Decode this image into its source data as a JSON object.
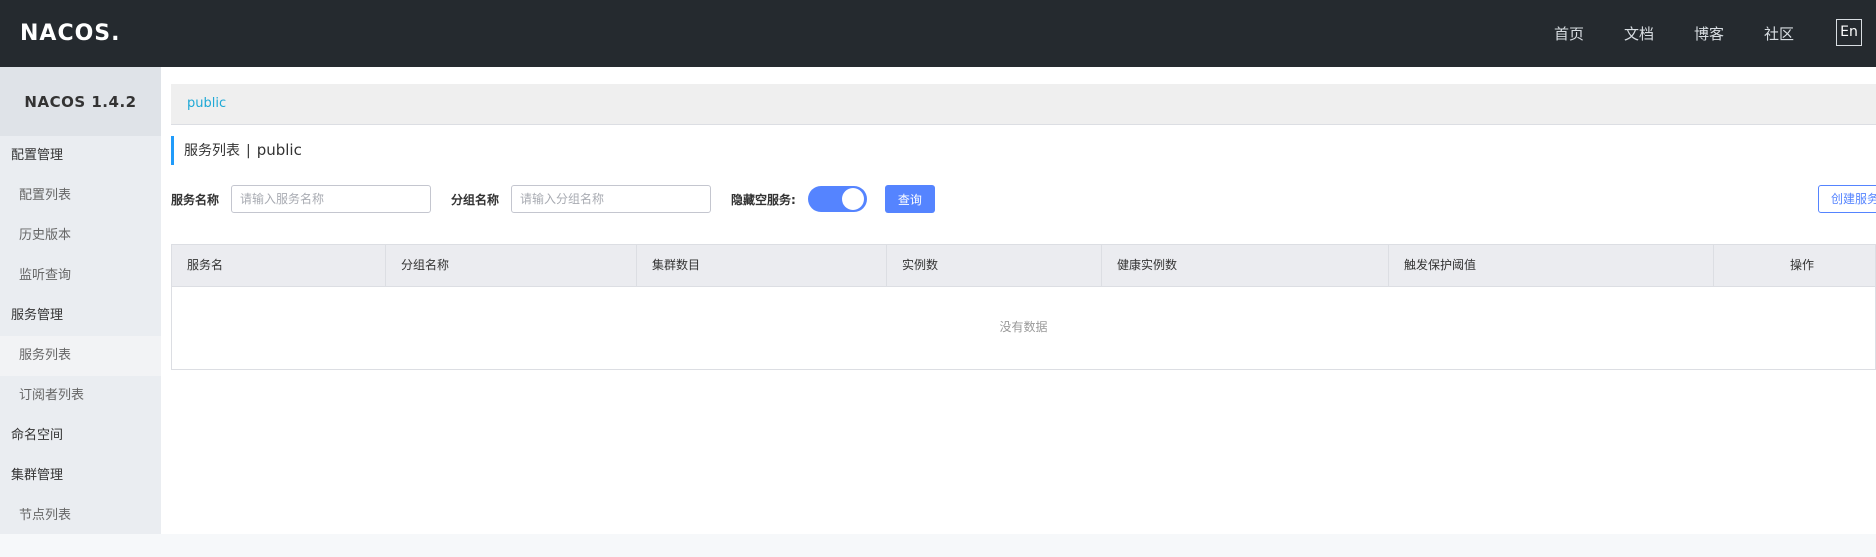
{
  "topbar": {
    "logo_text": "NACOS.",
    "nav": [
      "首页",
      "文档",
      "博客",
      "社区"
    ],
    "lang": "En"
  },
  "sidebar": {
    "version": "NACOS 1.4.2",
    "groups": [
      {
        "label": "配置管理",
        "items": [
          "配置列表",
          "历史版本",
          "监听查询"
        ]
      },
      {
        "label": "服务管理",
        "items": [
          "服务列表",
          "订阅者列表"
        ]
      },
      {
        "label": "命名空间",
        "items": []
      },
      {
        "label": "集群管理",
        "items": [
          "节点列表"
        ]
      }
    ],
    "active_item": "服务列表"
  },
  "namespace_bar": {
    "current": "public"
  },
  "page": {
    "title": "服务列表",
    "separator": "|",
    "namespace": "public"
  },
  "filter": {
    "service_name_label": "服务名称",
    "service_name_placeholder": "请输入服务名称",
    "group_name_label": "分组名称",
    "group_name_placeholder": "请输入分组名称",
    "hide_empty_label": "隐藏空服务:",
    "hide_empty_on": true,
    "query_button": "查询",
    "create_button": "创建服务"
  },
  "table": {
    "columns": [
      "服务名",
      "分组名称",
      "集群数目",
      "实例数",
      "健康实例数",
      "触发保护阈值",
      "操作"
    ],
    "rows": [],
    "empty_text": "没有数据"
  },
  "colors": {
    "topbar": "#252a2f",
    "accent": "#5584ff",
    "link": "#1fa9d6"
  }
}
